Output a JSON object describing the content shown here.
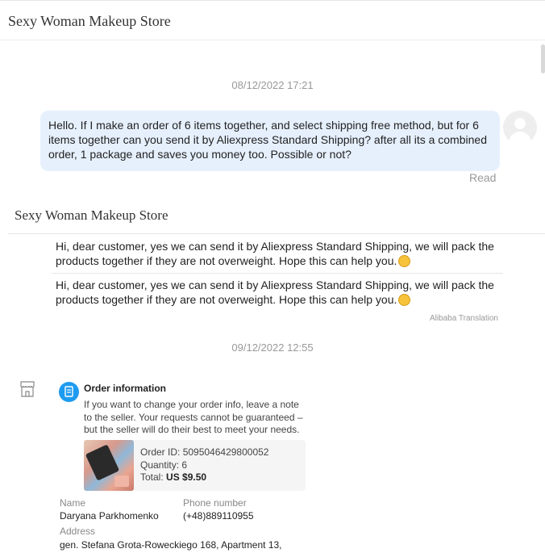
{
  "header": {
    "store_name": "Sexy Woman Makeup Store"
  },
  "conversation": {
    "timestamp_1": "08/12/2022 17:21",
    "outgoing_message": "Hello. If I make an order of 6 items together, and select shipping free method, but for 6 items together can you send it by Aliexpress Standard Shipping? after all its a combined order, 1 package and saves you money too. Possible or not?",
    "read_status": "Read",
    "seller_name": "Sexy Woman Makeup Store",
    "seller_reply_original": "Hi, dear customer, yes we can   send it by Aliexpress Standard Shipping, we will pack the products together if they are not overweight. Hope this can help you.",
    "seller_reply_translated": "Hi, dear customer, yes we can   send it by Aliexpress Standard Shipping, we will pack the products together if they are not overweight. Hope this can help you.",
    "translation_note": "Alibaba Translation",
    "timestamp_2": "09/12/2022 12:55"
  },
  "order_card": {
    "title": "Order information",
    "description": "If you want to change your order info, leave a note to the seller. Your requests cannot be guaranteed – but the seller will do their best to meet your needs.",
    "order_id_label": "Order ID:",
    "order_id": "5095046429800052",
    "quantity_label": "Quantity:",
    "quantity": "6",
    "total_label": "Total:",
    "total": "US $9.50"
  },
  "contact": {
    "name_label": "Name",
    "name": "Daryana Parkhomenko",
    "phone_label": "Phone number",
    "phone": "(+48)889110955",
    "address_label": "Address",
    "address": "gen. Stefana Grota-Roweckiego 168, Apartment 13,"
  },
  "icons": {
    "avatar": "user-avatar-icon",
    "store": "store-icon",
    "order": "order-document-icon",
    "emoji": "smile-emoji-icon"
  },
  "colors": {
    "outgoing_bubble": "#e6f0fd",
    "order_icon": "#1d9bf0",
    "muted_text": "#999999"
  }
}
